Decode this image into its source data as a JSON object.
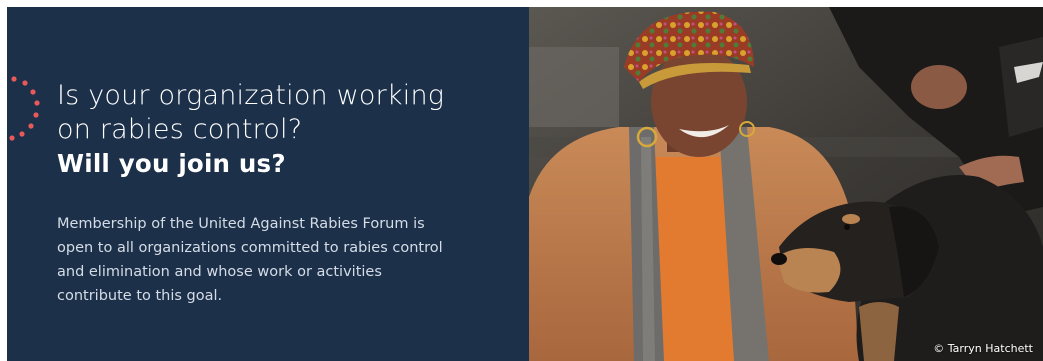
{
  "headline": {
    "line1": "Is your organization working",
    "line2": "on rabies control?",
    "line3": "Will you join us?"
  },
  "body": "Membership of the United Against Rabies Forum is open to all organizations committed to rabies control and elimination and whose work or activities contribute to this goal.",
  "photo": {
    "credit": "© Tarryn Hatchett"
  },
  "colors": {
    "panel_background": "#1c3049",
    "accent_dots": "#e85a5a",
    "text": "#ffffff"
  }
}
